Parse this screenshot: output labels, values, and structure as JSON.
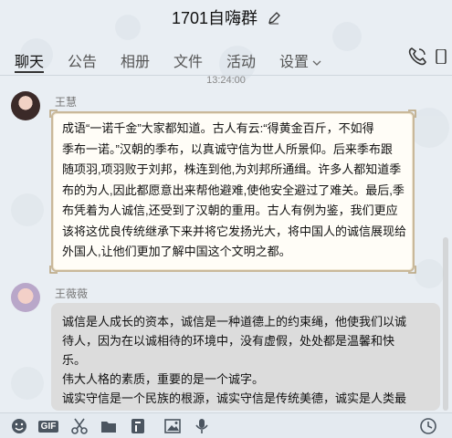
{
  "header": {
    "title": "1701自嗨群"
  },
  "tabs": [
    {
      "label": "聊天"
    },
    {
      "label": "公告"
    },
    {
      "label": "相册"
    },
    {
      "label": "文件"
    },
    {
      "label": "活动"
    },
    {
      "label": "设置"
    }
  ],
  "chat": {
    "timestamp": "13:24:00",
    "messages": [
      {
        "sender": "王慧",
        "lines": [
          "成语“一诺千金”大家都知道。古人有云:“得黄金百斤，不如得",
          "季布一诺。”汉朝的季布，以真诚守信为世人所景仰。后来季布跟",
          "随项羽,项羽败于刘邦，株连到他,为刘邦所通缉。许多人都知道季",
          "布的为人,因此都愿意出来帮他避难,使他安全避过了难关。最后,季",
          "布凭着为人诚信,还受到了汉朝的重用。古人有例为鉴，我们更应",
          "该将这优良传统继承下来并将它发扬光大，将中国人的诚信展现给",
          "外国人,让他们更加了解中国这个文明之都。"
        ]
      },
      {
        "sender": "王薇薇",
        "lines": [
          "诚信是人成长的资本，诚信是一种道德上的约束绳，他使我们以诚",
          "待人，因为在以诚相待的环境中，没有虚假，处处都是温馨和快",
          "乐。",
          "伟大人格的素质，重要的是一个诚字。",
          "诚实守信是一个民族的根源，诚实守信是传统美德，诚实是人类最"
        ]
      }
    ]
  },
  "toolbar": {
    "icons": [
      "emoji-icon",
      "gif-icon",
      "scissors-icon",
      "folder-icon",
      "doc-icon",
      "image-icon",
      "mic-icon",
      "clock-icon"
    ],
    "gif_label": "GIF"
  }
}
